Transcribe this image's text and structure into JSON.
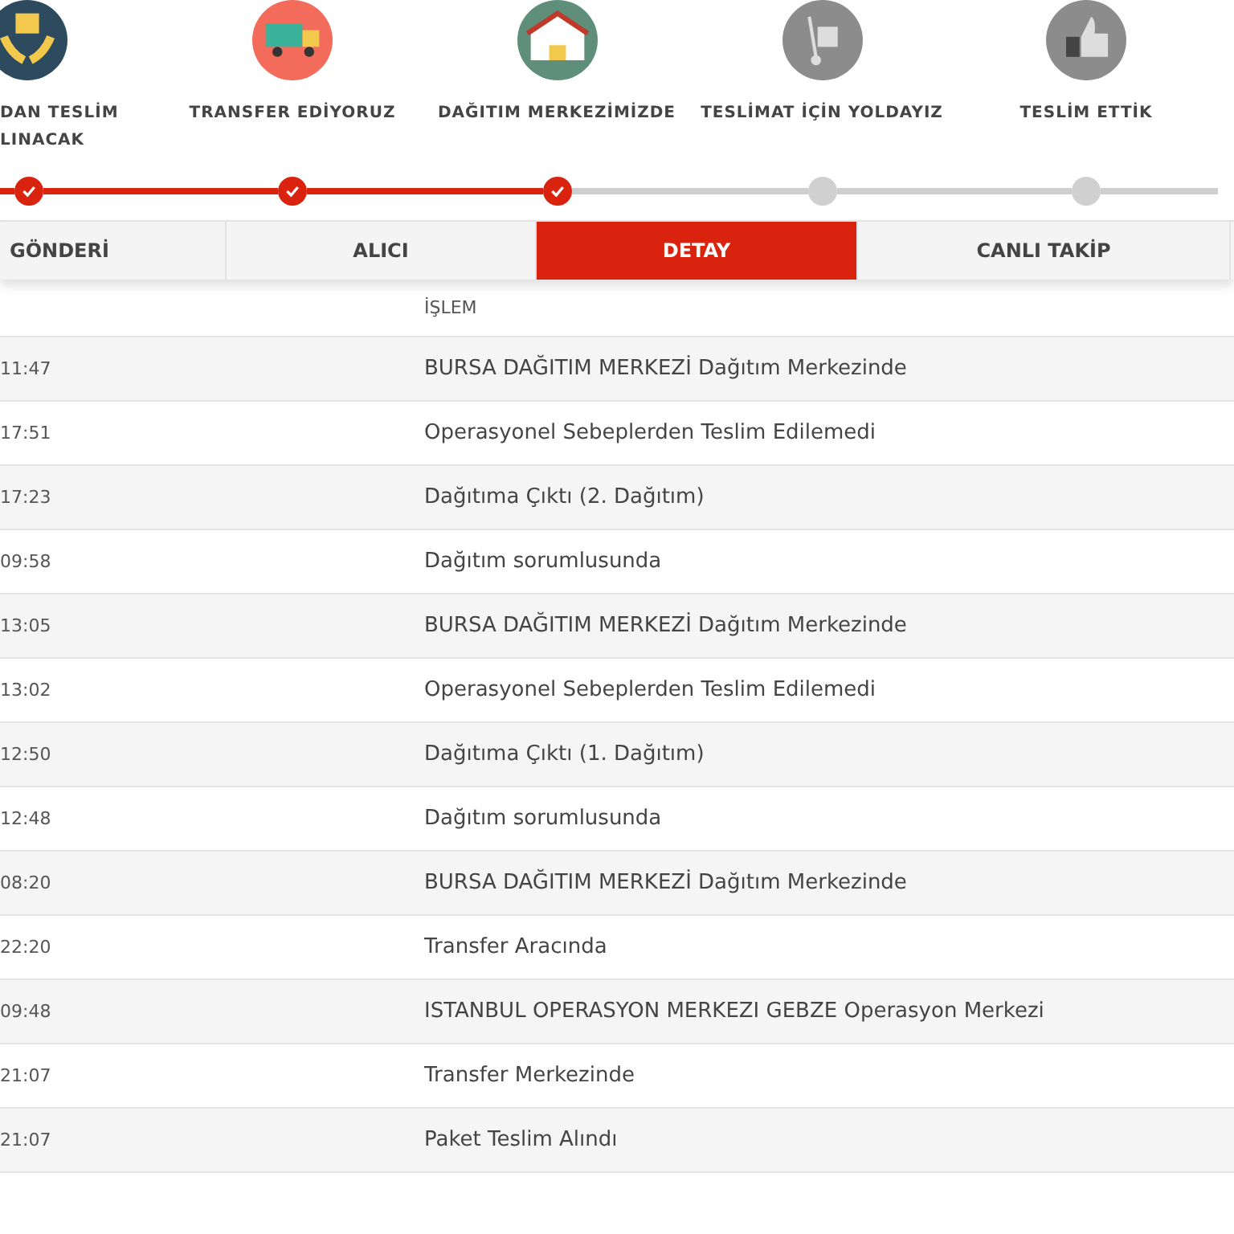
{
  "steps": [
    {
      "label": "DAN TESLİM LINACAK",
      "kind": "hands",
      "color": "#2e4a5e",
      "completed": true
    },
    {
      "label": "TRANSFER EDİYORUZ",
      "kind": "truck",
      "color": "#f26b5b",
      "completed": true
    },
    {
      "label": "DAĞITIM MERKEZİMİZDE",
      "kind": "warehouse",
      "color": "#5f8f7b",
      "completed": true
    },
    {
      "label": "TESLİMAT İÇİN YOLDAYIZ",
      "kind": "trolley",
      "color": "#8c8c8c",
      "completed": false
    },
    {
      "label": "TESLİM ETTİK",
      "kind": "thumb",
      "color": "#8c8c8c",
      "completed": false
    }
  ],
  "tabs": [
    {
      "label": "GÖNDERİ",
      "selected": false
    },
    {
      "label": "ALICI",
      "selected": false
    },
    {
      "label": "DETAY",
      "selected": true
    },
    {
      "label": "CANLI TAKİP",
      "selected": false
    }
  ],
  "table": {
    "columns": [
      "İŞLEM"
    ],
    "rows": [
      {
        "time": "11:47",
        "action": "BURSA DAĞITIM MERKEZİ Dağıtım Merkezinde"
      },
      {
        "time": "17:51",
        "action": "Operasyonel Sebeplerden Teslim Edilemedi"
      },
      {
        "time": "17:23",
        "action": "Dağıtıma Çıktı (2. Dağıtım)"
      },
      {
        "time": "09:58",
        "action": "Dağıtım sorumlusunda"
      },
      {
        "time": "13:05",
        "action": "BURSA DAĞITIM MERKEZİ Dağıtım Merkezinde"
      },
      {
        "time": "13:02",
        "action": "Operasyonel Sebeplerden Teslim Edilemedi"
      },
      {
        "time": "12:50",
        "action": "Dağıtıma Çıktı (1. Dağıtım)"
      },
      {
        "time": "12:48",
        "action": "Dağıtım sorumlusunda"
      },
      {
        "time": "08:20",
        "action": "BURSA DAĞITIM MERKEZİ Dağıtım Merkezinde"
      },
      {
        "time": "22:20",
        "action": "Transfer Aracında"
      },
      {
        "time": "09:48",
        "action": "ISTANBUL OPERASYON MERKEZI GEBZE Operasyon Merkezi"
      },
      {
        "time": "21:07",
        "action": "Transfer Merkezinde"
      },
      {
        "time": "21:07",
        "action": "Paket Teslim Alındı"
      }
    ]
  }
}
